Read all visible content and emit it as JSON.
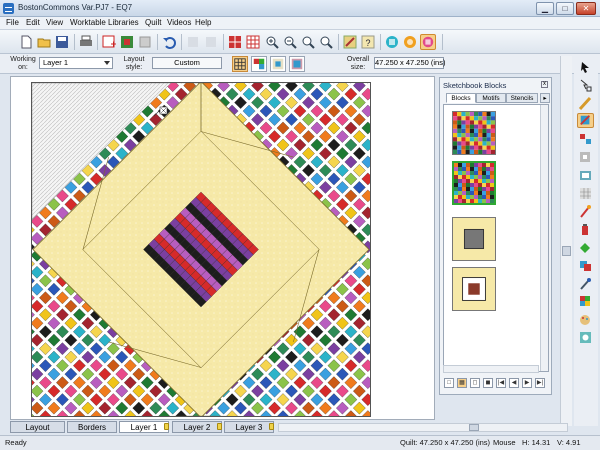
{
  "window": {
    "title": "BostonCommons Var.PJ7 - EQ7",
    "min_label": "▁",
    "max_label": "□",
    "close_label": "✕"
  },
  "menu": [
    "File",
    "Edit",
    "View",
    "Worktable",
    "Libraries",
    "Quilt",
    "Videos",
    "Help"
  ],
  "toolbar": {
    "icons": [
      "new-icon",
      "open-icon",
      "save-icon",
      "print-icon",
      "new-block-icon",
      "add-block-icon",
      "delete-icon",
      "undo-icon",
      "copy-icon",
      "paste-icon",
      "grid-icon",
      "show-grid-icon",
      "zoom-in-icon",
      "zoom-out-icon",
      "zoom-fit-icon",
      "zoom-icon",
      "edit-quilt-icon",
      "help-icon",
      "block-worktable-icon",
      "image-worktable-icon",
      "quilt-worktable-icon"
    ]
  },
  "options": {
    "working_on_label": "Working on:",
    "working_on_value": "Layer 1",
    "layout_style_label": "Layout style:",
    "layout_style_value": "Custom",
    "overall_size_label": "Overall size:",
    "overall_size_value": "47.250 x 47.250 (ins)"
  },
  "sketchbook": {
    "title": "Sketchbook Blocks",
    "close_label": "x",
    "tabs": [
      "Blocks",
      "Motifs",
      "Stencils"
    ],
    "nav_buttons": [
      "□",
      "▦",
      "◻",
      "◼",
      "|◀",
      "◀",
      "▶",
      "▶|"
    ]
  },
  "bottom_tabs": [
    "Layout",
    "Borders",
    "Layer 1",
    "Layer 2",
    "Layer 3"
  ],
  "status": {
    "left": "Ready",
    "quilt": "Quilt: 47.250 x 47.250 (ins)",
    "mouse": "Mouse",
    "h": "H: 14.31",
    "v": "V: 4.91"
  },
  "colors": {
    "cream": "#f6e9a8",
    "cream_dot": "#fbf3cf",
    "palette": [
      "#d62a2a",
      "#1f7a33",
      "#2b57b8",
      "#f0c419",
      "#7b3fa0",
      "#f07b1d",
      "#2bb3c9",
      "#e94a8a",
      "#1d1d1d",
      "#8bc34a",
      "#a4242f",
      "#3aa0e0",
      "#b85dbf",
      "#f5d54e",
      "#cc5a16",
      "#2e8b57"
    ]
  }
}
